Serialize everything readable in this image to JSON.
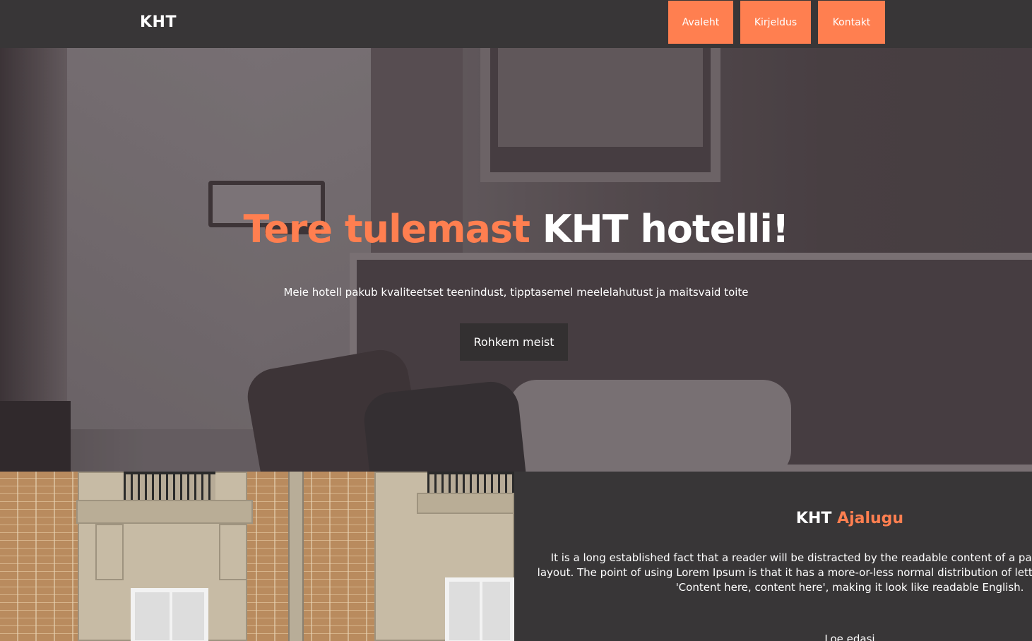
{
  "navbar": {
    "logo": "KHT",
    "links": [
      "Avaleht",
      "Kirjeldus",
      "Kontakt"
    ]
  },
  "hero": {
    "title_accent": "Tere tulemast",
    "title_rest": " KHT hotelli!",
    "subtitle": "Meie hotell pakub kvaliteetset teenindust, tipptasemel meelelahutust ja maitsvaid toite",
    "button_label": "Rohkem meist"
  },
  "history": {
    "title_main": "KHT ",
    "title_accent": "Ajalugu",
    "text": "It is a long established fact that a reader will be distracted by the readable content of a page when looking at its layout. The point of using Lorem Ipsum is that it has a more-or-less normal distribution of letters, as opposed to using 'Content here, content here', making it look like readable English.",
    "more_label": "Loe edasi"
  },
  "colors": {
    "accent": "#ff7f50",
    "dark": "#383637",
    "button_dark": "#333031"
  }
}
